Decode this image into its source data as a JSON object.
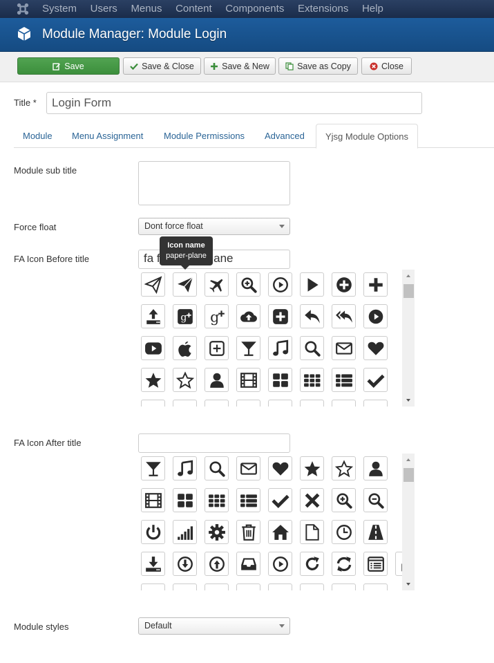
{
  "topbar": {
    "menu": [
      "System",
      "Users",
      "Menus",
      "Content",
      "Components",
      "Extensions",
      "Help"
    ]
  },
  "header": {
    "title": "Module Manager: Module Login"
  },
  "toolbar": {
    "save": "Save",
    "save_close": "Save & Close",
    "save_new": "Save & New",
    "save_copy": "Save as Copy",
    "close": "Close"
  },
  "form": {
    "title_label": "Title *",
    "title_value": "Login Form"
  },
  "tabs": [
    "Module",
    "Menu Assignment",
    "Module Permissions",
    "Advanced",
    "Yjsg Module Options"
  ],
  "options": {
    "subtitle_label": "Module sub title",
    "force_float_label": "Force float",
    "force_float_value": "Dont force float",
    "icon_before_label": "FA Icon Before title",
    "icon_before_value": "fa fa-paper-plane",
    "icon_after_label": "FA Icon After title",
    "icon_after_value": "",
    "styles_label": "Module styles",
    "styles_value": "Default"
  },
  "tooltip": {
    "title": "Icon name",
    "value": "paper-plane"
  },
  "colors": {
    "save_green": "#46a546",
    "header_blue": "#1a5796",
    "link_blue": "#2a6496"
  },
  "icons_before": [
    [
      "paper-plane-o",
      "paper-plane",
      "plane",
      "search-plus",
      "play-circle-o",
      "play",
      "plus-circle",
      "plus"
    ],
    [
      "upload",
      "google-plus-square",
      "google-plus",
      "cloud-upload",
      "plus-square",
      "reply",
      "reply-all",
      "play-circle"
    ],
    [
      "youtube-play",
      "apple",
      "plus-square-o",
      "glass",
      "music",
      "search",
      "envelope-o",
      "heart"
    ],
    [
      "star",
      "star-o",
      "user",
      "film",
      "th-large",
      "th",
      "th-list",
      "check"
    ]
  ],
  "icons_after": [
    [
      "glass",
      "music",
      "search",
      "envelope-o",
      "heart",
      "star",
      "star-o",
      "user"
    ],
    [
      "film",
      "th-large",
      "th",
      "th-list",
      "check",
      "times",
      "search-plus",
      "search-minus"
    ],
    [
      "power-off",
      "signal",
      "cog",
      "trash-o",
      "home",
      "file-o",
      "clock-o",
      "road"
    ],
    [
      "download",
      "arrow-circle-o-down",
      "arrow-circle-o-up",
      "inbox",
      "play-circle-o",
      "repeat",
      "refresh",
      "list-alt",
      "lock"
    ]
  ]
}
